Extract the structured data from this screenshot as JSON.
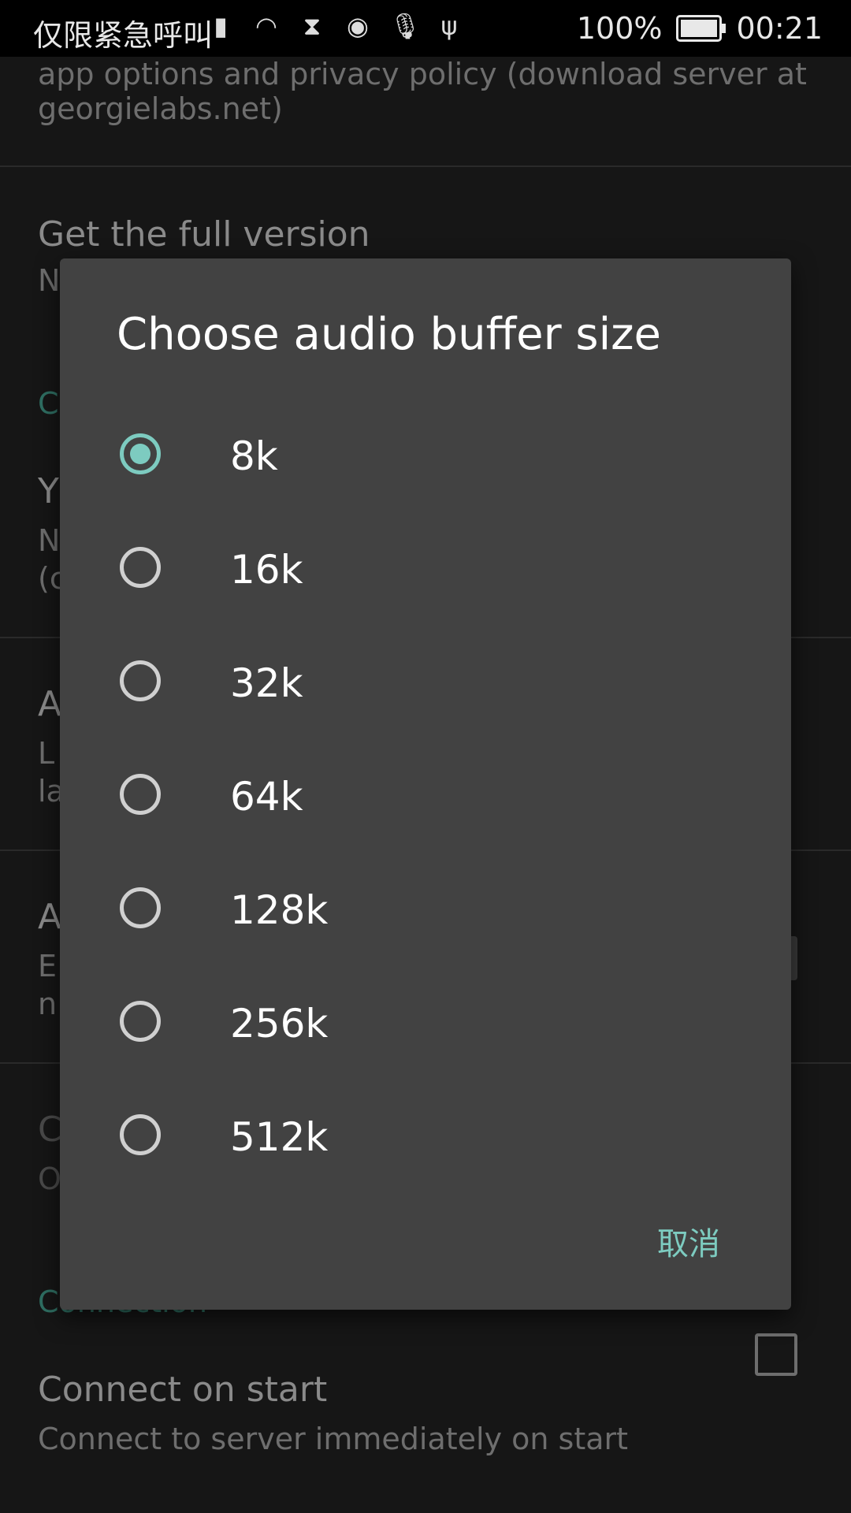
{
  "status_bar": {
    "carrier": "仅限紧急呼叫",
    "icons": [
      "signal-icon",
      "wifi-icon",
      "hourglass-icon",
      "spotify-icon",
      "mic-icon",
      "usb-icon"
    ],
    "battery": "100%",
    "battery_level": 1.0,
    "time": "00:21"
  },
  "background": {
    "text1": "app options and privacy policy (download server at",
    "text2": "georgielabs.net)",
    "item_full_version": "Get the full version",
    "item_full_version_sub": "N",
    "section_c": "C",
    "y_title": "Y",
    "y_sub1": "N",
    "y_sub2": "(c",
    "a1_title": "A",
    "a1_sub1": "L",
    "a1_sub2": "la",
    "a2_title": "A",
    "a2_sub1": "E",
    "a2_sub2": "n",
    "c2_title": "C",
    "c2_sub": "O",
    "connection_section": "Connection",
    "connect_on_start": "Connect on start",
    "connect_on_start_sub": "Connect to server immediately on start"
  },
  "dialog": {
    "title": "Choose audio buffer size",
    "options": [
      "8k",
      "16k",
      "32k",
      "64k",
      "128k",
      "256k",
      "512k"
    ],
    "selected": "8k",
    "cancel_label": "取消"
  },
  "colors": {
    "accent": "#7dcbc0",
    "dialog_bg": "#424242",
    "page_bg": "#161616"
  }
}
